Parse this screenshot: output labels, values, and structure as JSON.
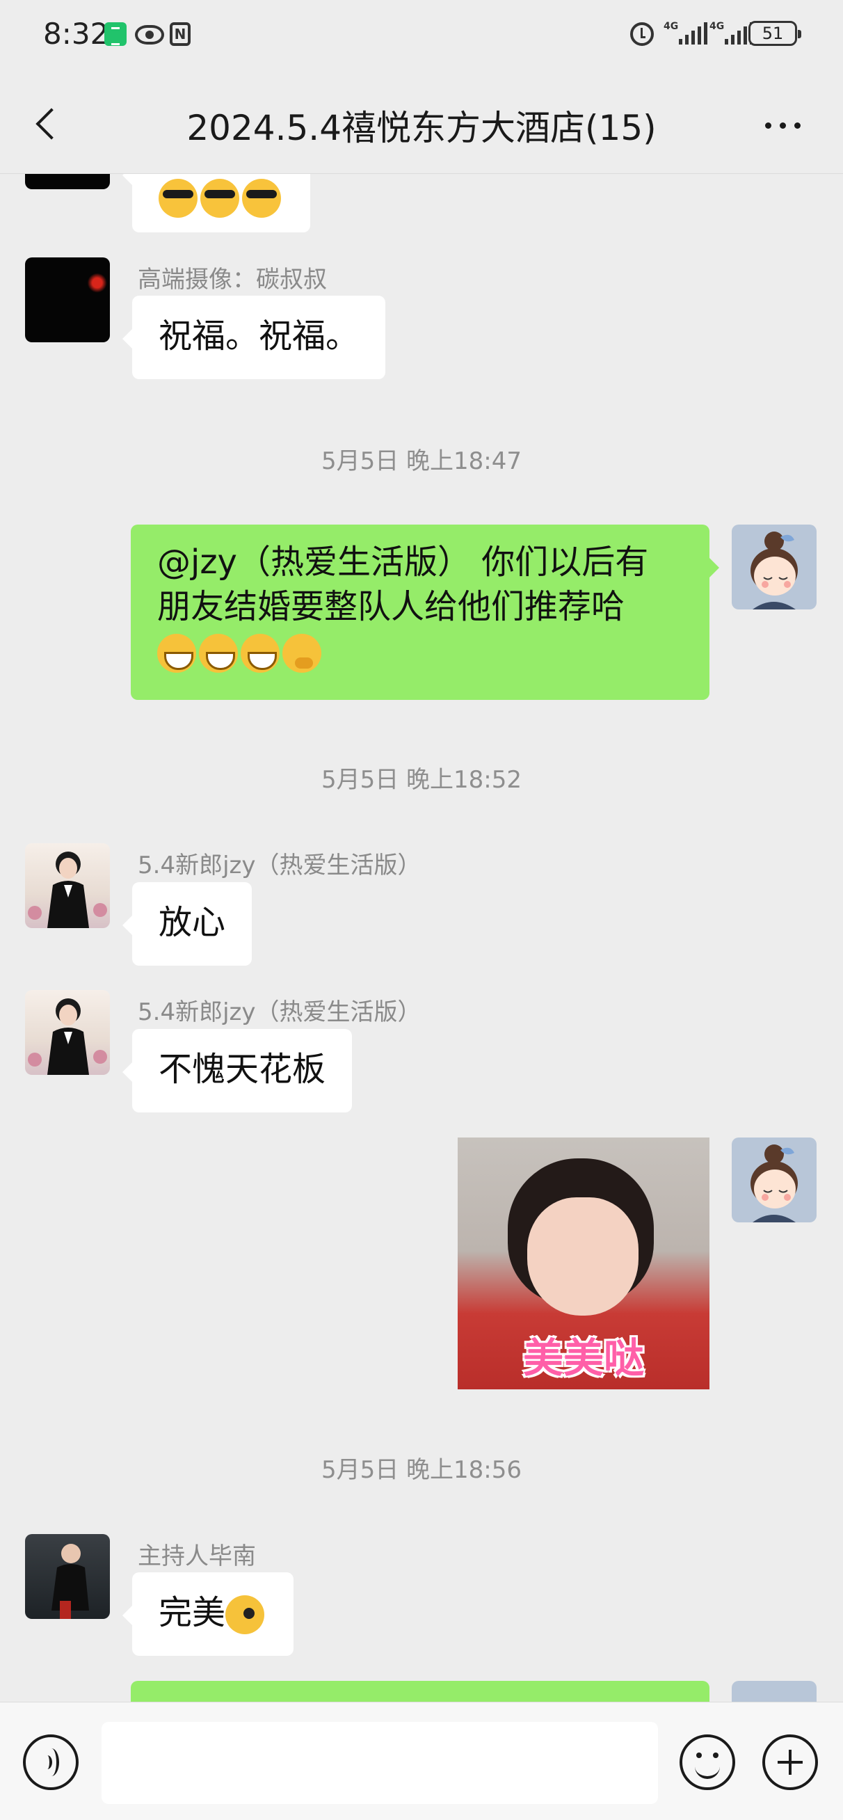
{
  "status_bar": {
    "time": "8:32",
    "network": "4G",
    "battery": "51"
  },
  "header": {
    "title": "2024.5.4禧悦东方大酒店(15)"
  },
  "messages": [
    {
      "sender": "高端摄像：碳叔叔",
      "text": "祝福。祝福。"
    },
    {
      "timestamp": "5月5日 晚上18:47"
    },
    {
      "text_line1": "@jzy（热爱生活版） 你们以后有",
      "text_line2": "朋友结婚要整队人给他们推荐哈"
    },
    {
      "timestamp": "5月5日 晚上18:52"
    },
    {
      "sender": "5.4新郎jzy（热爱生活版）",
      "text": "放心"
    },
    {
      "sender": "5.4新郎jzy（热爱生活版）",
      "text": "不愧天花板"
    },
    {
      "image_caption": "美美哒"
    },
    {
      "timestamp": "5月5日 晚上18:56"
    },
    {
      "sender": "主持人毕南",
      "text": "完美"
    }
  ],
  "icons": {
    "back": "chevron-left-icon",
    "more": "more-horizontal-icon",
    "voice": "voice-icon",
    "emoji": "emoji-icon",
    "plus": "plus-icon"
  },
  "colors": {
    "background": "#ededed",
    "outgoing_bubble": "#95ec69",
    "incoming_bubble": "#ffffff"
  }
}
